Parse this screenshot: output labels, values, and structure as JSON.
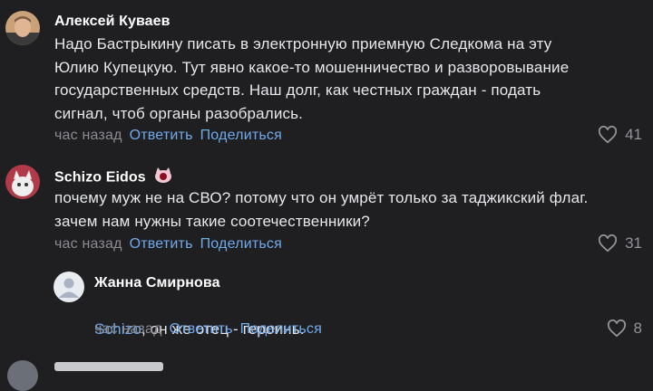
{
  "comments": [
    {
      "author": "Алексей Куваев",
      "text": "Надо Бастрыкину писать в электронную приемную Следкома на эту\nЮлию Купецкую. Тут явно какое-то мошенничество и разворовывание\nгосударственных средств. Наш долг, как честных граждан - подать\nсигнал, чтоб органы разобрались.",
      "time": "час назад",
      "reply_label": "Ответить",
      "share_label": "Поделиться",
      "likes": "41"
    },
    {
      "author": "Schizo Eidos",
      "text": "почему муж не на СВО? потому что он умрёт только за таджикский флаг.\nзачем нам нужны такие соотечественники?",
      "time": "час назад",
      "reply_label": "Ответить",
      "share_label": "Поделиться",
      "likes": "31"
    }
  ],
  "reply": {
    "author": "Жанна Смирнова",
    "mention": "Schizo",
    "text": ", он же отец - героинь.",
    "time": "час назад",
    "reply_label": "Ответить",
    "share_label": "Поделиться",
    "likes": "8"
  },
  "icons": {
    "like": "heart-icon",
    "badge": "cat-badge-icon"
  },
  "colors": {
    "background": "#1f1f21",
    "link": "#71aaeb",
    "meta": "#8a8b90"
  }
}
